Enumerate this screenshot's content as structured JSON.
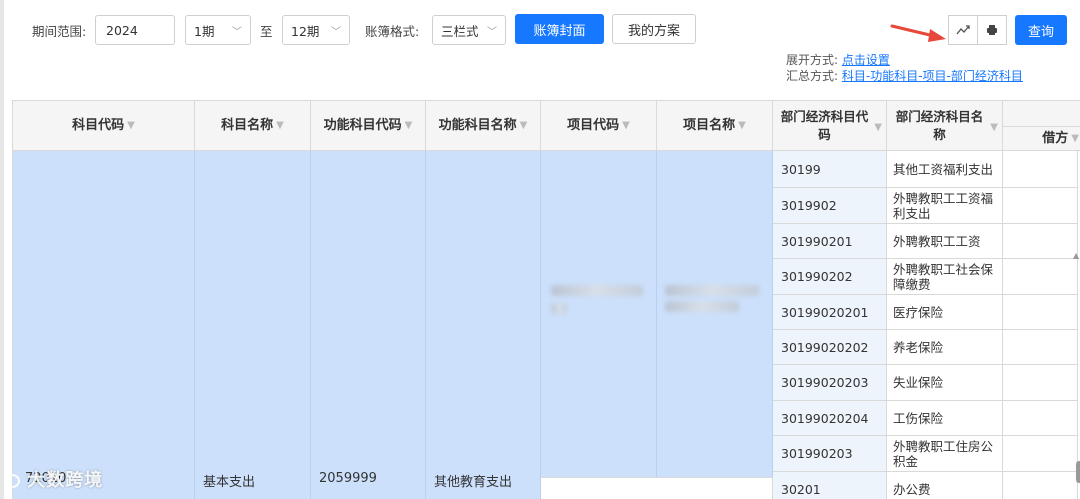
{
  "toolbar": {
    "period_label": "期间范围:",
    "year_value": "2024",
    "start_period": "1期",
    "to_label": "至",
    "end_period": "12期",
    "format_label": "账簿格式:",
    "format_value": "三栏式",
    "cover_button": "账簿封面",
    "scheme_button": "我的方案",
    "chart_icon": "trend-chart-icon",
    "print_icon": "printer-icon",
    "query_button": "查询",
    "expand_label": "展开方式:",
    "expand_link": "点击设置",
    "summary_label": "汇总方式:",
    "summary_link": "科目-功能科目-项目-部门经济科目"
  },
  "table": {
    "headers": [
      "科目代码",
      "科目名称",
      "功能科目代码",
      "功能科目名称",
      "项目代码",
      "项目名称",
      "部门经济科目代码",
      "部门经济科目名称",
      "借方"
    ],
    "merged": {
      "subject_code": "72010",
      "subject_name": "基本支出",
      "func_code": "2059999",
      "func_name": "其他教育支出"
    },
    "rows": [
      {
        "code": "30199",
        "name": "其他工资福利支出"
      },
      {
        "code": "3019902",
        "name": "外聘教职工工资福利支出"
      },
      {
        "code": "301990201",
        "name": "外聘教职工工资"
      },
      {
        "code": "301990202",
        "name": "外聘教职工社会保障缴费"
      },
      {
        "code": "30199020201",
        "name": "医疗保险"
      },
      {
        "code": "30199020202",
        "name": "养老保险"
      },
      {
        "code": "30199020203",
        "name": "失业保险"
      },
      {
        "code": "30199020204",
        "name": "工伤保险"
      },
      {
        "code": "301990203",
        "name": "外聘教职工住房公积金"
      },
      {
        "code": "30201",
        "name": "办公费"
      }
    ]
  },
  "watermark": "大数跨境"
}
